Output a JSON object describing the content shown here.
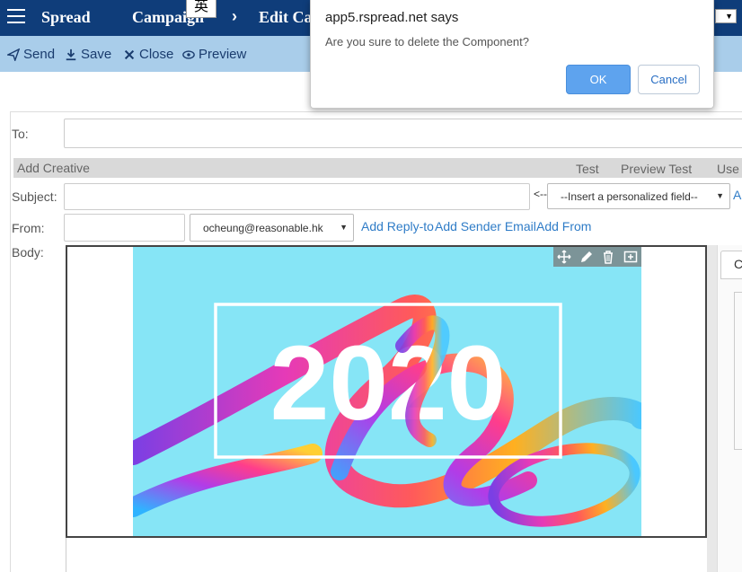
{
  "navbar": {
    "brand": "Spread",
    "crumbs": [
      "Campaign",
      "Edit Ca"
    ],
    "ime_char": "英",
    "right_select_caret": "▼"
  },
  "toolbar": {
    "send": "Send",
    "save": "Save",
    "close": "Close",
    "preview": "Preview"
  },
  "form": {
    "to_label": "To:",
    "section_title": "Add Creative",
    "section_actions": [
      "Test",
      "Preview Test",
      "Use"
    ],
    "subject_label": "Subject:",
    "arrow_hint": "<--",
    "personalized_select": "--Insert a personalized field--",
    "subject_trailing_link": "A",
    "from_label": "From:",
    "from_select": "ocheung@reasonable.hk",
    "links": [
      "Add Reply-to",
      "Add Sender Email",
      "Add From"
    ],
    "body_label": "Body:"
  },
  "editor": {
    "image_text": "2020",
    "tools": [
      "move-icon",
      "pencil-icon",
      "trash-icon",
      "add-icon"
    ]
  },
  "right_panel": {
    "tab_label": "C"
  },
  "dialog": {
    "title": "app5.rspread.net says",
    "message": "Are you sure to delete the Component?",
    "ok": "OK",
    "cancel": "Cancel"
  },
  "colors": {
    "navbar": "#0f3d7a",
    "toolbar": "#a9cdea",
    "link": "#2f7cc7",
    "ok_button": "#5ea3ee",
    "image_bg": "#86e5f6"
  }
}
